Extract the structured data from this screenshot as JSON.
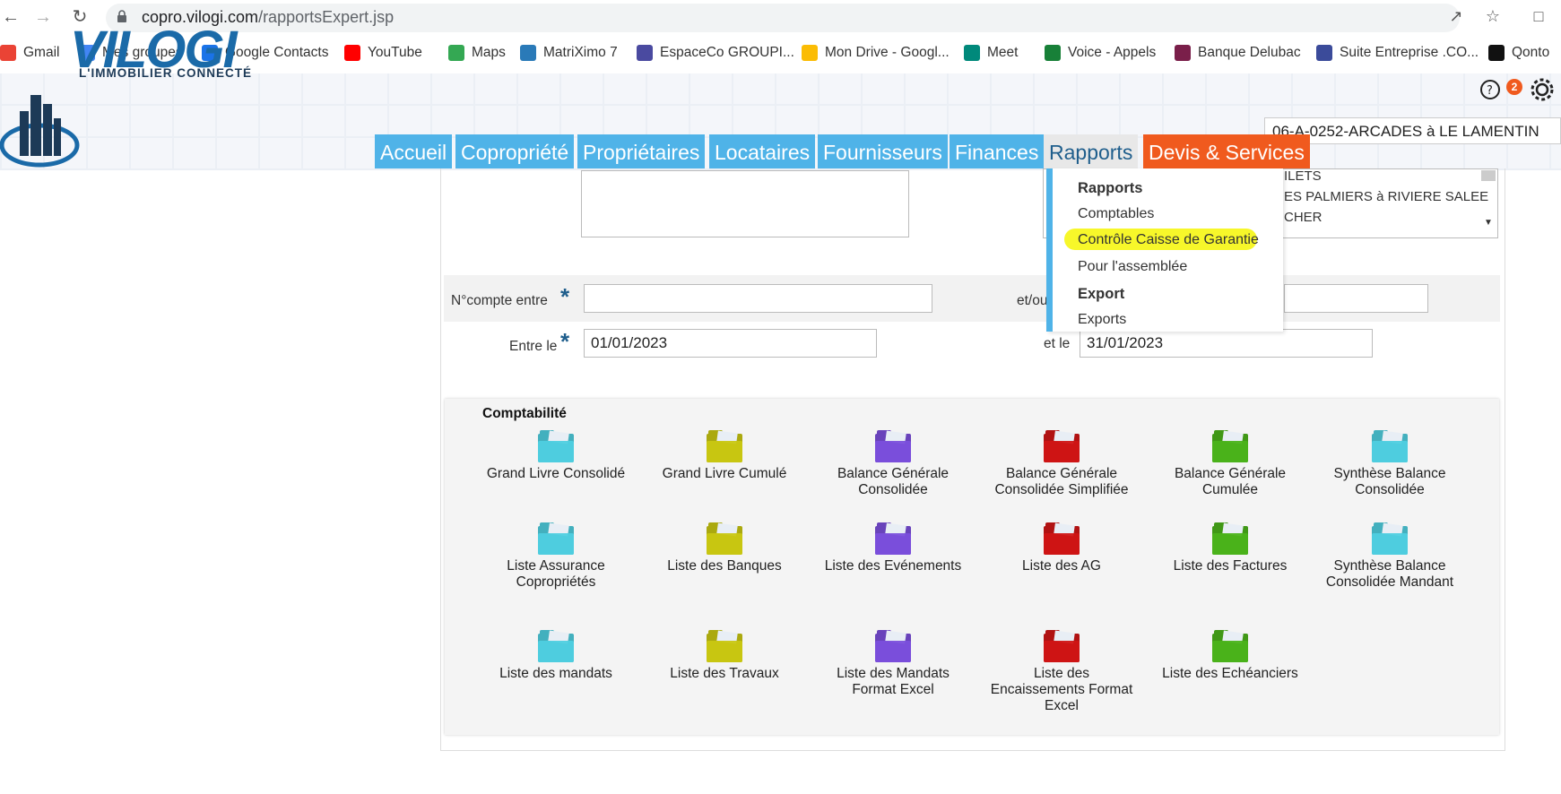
{
  "browser": {
    "url_host": "copro.vilogi.com",
    "url_path": "/rapportsExpert.jsp"
  },
  "bookmarks": [
    {
      "label": "Gmail",
      "icon": "gmail-icon",
      "color": "#ea4335"
    },
    {
      "label": "Mes groupes",
      "icon": "groups-icon",
      "color": "#4285f4"
    },
    {
      "label": "Google Contacts",
      "icon": "contacts-icon",
      "color": "#1a73e8"
    },
    {
      "label": "YouTube",
      "icon": "youtube-icon",
      "color": "#ff0000"
    },
    {
      "label": "Maps",
      "icon": "maps-icon",
      "color": "#34a853"
    },
    {
      "label": "MatriXimo 7",
      "icon": "matriximo-icon",
      "color": "#2a7ab8"
    },
    {
      "label": "EspaceCo GROUPI...",
      "icon": "espaceco-icon",
      "color": "#4a4aa0"
    },
    {
      "label": "Mon Drive - Googl...",
      "icon": "drive-icon",
      "color": "#fbbc04"
    },
    {
      "label": "Meet",
      "icon": "meet-icon",
      "color": "#00897b"
    },
    {
      "label": "Voice - Appels",
      "icon": "voice-icon",
      "color": "#188038"
    },
    {
      "label": "Banque Delubac",
      "icon": "delubac-icon",
      "color": "#7a1f4a"
    },
    {
      "label": "Suite Entreprise .CO...",
      "icon": "suite-icon",
      "color": "#3b4b9a"
    },
    {
      "label": "Qonto",
      "icon": "qonto-icon",
      "color": "#111111"
    }
  ],
  "header": {
    "logo_text": "VILOGI",
    "logo_subtitle": "L'IMMOBILIER CONNECTÉ",
    "notification_count": "2",
    "copro_selected": "06-A-0252-ARCADES à LE LAMENTIN"
  },
  "nav_tabs": [
    {
      "label": "Accueil"
    },
    {
      "label": "Copropriété"
    },
    {
      "label": "Propriétaires"
    },
    {
      "label": "Locataires"
    },
    {
      "label": "Fournisseurs"
    },
    {
      "label": "Finances"
    },
    {
      "label": "Rapports"
    },
    {
      "label": "Devis & Services"
    }
  ],
  "copro_list": [
    "ILETS",
    "ES PALMIERS à RIVIERE SALEE",
    "CHER"
  ],
  "rapports_menu": {
    "section1_title": "Rapports",
    "items1": [
      "Comptables",
      "Contrôle Caisse de Garantie",
      "Pour l'assemblée"
    ],
    "section2_title": "Export",
    "items2": [
      "Exports"
    ]
  },
  "form": {
    "ncompte_label": "N°compte entre",
    "ncompte_from": "",
    "etou_label": "et/ou",
    "ncompte_to": "",
    "entre_le_label": "Entre le",
    "date_from": "01/01/2023",
    "et_le_label": "et le",
    "date_to": "31/01/2023"
  },
  "comptabilite": {
    "title": "Comptabilité",
    "reports": [
      {
        "label": "Grand Livre Consolidé",
        "color": "#4fcfe0"
      },
      {
        "label": "Grand Livre Cumulé",
        "color": "#c9c712"
      },
      {
        "label": "Balance Générale Consolidée",
        "color": "#7b4fdc"
      },
      {
        "label": "Balance Générale Consolidée Simplifiée",
        "color": "#d01515"
      },
      {
        "label": "Balance Générale Cumulée",
        "color": "#4bb31a"
      },
      {
        "label": "Synthèse Balance Consolidée",
        "color": "#4fcfe0"
      },
      {
        "label": "Liste Assurance Copropriétés",
        "color": "#4fcfe0"
      },
      {
        "label": "Liste des Banques",
        "color": "#c9c712"
      },
      {
        "label": "Liste des Evénements",
        "color": "#7b4fdc"
      },
      {
        "label": "Liste des AG",
        "color": "#d01515"
      },
      {
        "label": "Liste des Factures",
        "color": "#4bb31a"
      },
      {
        "label": "Synthèse Balance Consolidée Mandant",
        "color": "#4fcfe0"
      },
      {
        "label": "Liste des mandats",
        "color": "#4fcfe0"
      },
      {
        "label": "Liste des Travaux",
        "color": "#c9c712"
      },
      {
        "label": "Liste des Mandats Format Excel",
        "color": "#7b4fdc"
      },
      {
        "label": "Liste des Encaissements Format Excel",
        "color": "#d01515"
      },
      {
        "label": "Liste des Echéanciers",
        "color": "#4bb31a"
      }
    ]
  }
}
